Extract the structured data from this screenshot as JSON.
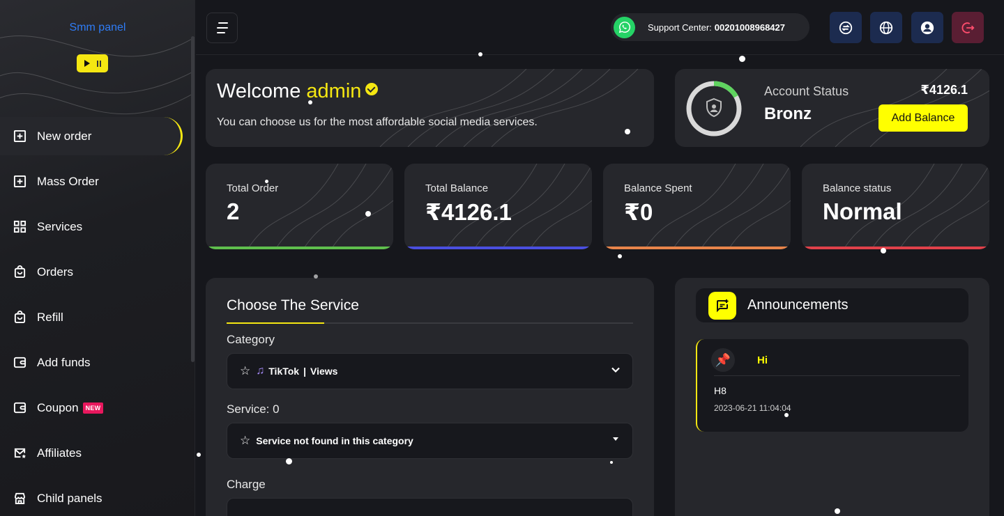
{
  "brand": {
    "logo_text": "Smm panel"
  },
  "sidebar": {
    "items": [
      {
        "label": "New order",
        "icon": "plus-square-icon",
        "active": true
      },
      {
        "label": "Mass Order",
        "icon": "plus-square-icon"
      },
      {
        "label": "Services",
        "icon": "grid-icon"
      },
      {
        "label": "Orders",
        "icon": "bag-icon"
      },
      {
        "label": "Refill",
        "icon": "bag-icon"
      },
      {
        "label": "Add funds",
        "icon": "wallet-icon"
      },
      {
        "label": "Coupon",
        "icon": "wallet-icon",
        "badge": "NEW"
      },
      {
        "label": "Affiliates",
        "icon": "mail-star-icon"
      },
      {
        "label": "Child panels",
        "icon": "store-icon"
      }
    ]
  },
  "topbar": {
    "support_label": "Support Center:",
    "support_phone": "00201008968427"
  },
  "welcome": {
    "greeting": "Welcome",
    "username": "admin",
    "subtitle": "You can choose us for the most affordable social media services."
  },
  "account": {
    "label": "Account Status",
    "tier": "Bronz",
    "balance": "₹4126.1",
    "add_balance_label": "Add Balance",
    "progress": 0.17
  },
  "stats": [
    {
      "label": "Total Order",
      "value": "2",
      "color": "#5fbf4d"
    },
    {
      "label": "Total Balance",
      "value": "₹4126.1",
      "color": "#4a4fe0"
    },
    {
      "label": "Balance Spent",
      "value": "₹0",
      "color": "#e8844a"
    },
    {
      "label": "Balance status",
      "value": "Normal",
      "color": "#e0414a"
    }
  ],
  "service_form": {
    "title": "Choose The Service",
    "category_label": "Category",
    "category_platform": "TikTok",
    "category_separator": "|",
    "category_type": "Views",
    "service_label": "Service: 0",
    "service_value": "Service not found in this category",
    "charge_label": "Charge"
  },
  "announcements": {
    "title": "Announcements",
    "items": [
      {
        "title": "Hi",
        "body": "H8",
        "date": "2023-06-21 11:04:04"
      }
    ]
  },
  "colors": {
    "accent": "#f5e712",
    "button_yellow": "#ffff00",
    "whatsapp": "#25d366",
    "top_icon_bg": "#1c2b4f",
    "logout_bg": "#5a1e33"
  }
}
